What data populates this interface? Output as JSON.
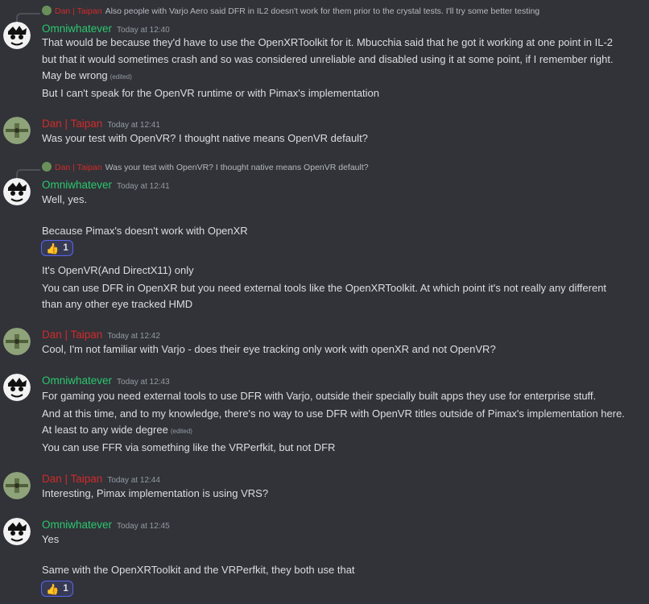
{
  "colors": {
    "background": "#313338",
    "omni_name": "#2dc770",
    "dan_name": "#d32a2a",
    "text": "#dbdee1",
    "muted": "#949ba4",
    "reaction_border": "#5865f2"
  },
  "top_reply": {
    "name": "Dan | Taipan",
    "text": "Also people with Varjo Aero said DFR in IL2 doesn't work for them prior to the crystal tests. I'll try some better testing"
  },
  "messages": [
    {
      "author": "Omniwhatever",
      "time": "Today at 12:40",
      "lines": [
        "That would be because they'd have to use the OpenXRToolkit for it. Mbucchia said that he got it working at one point in IL-2",
        "but that it would sometimes crash and so was considered unreliable and disabled using it at some point, if I remember right.",
        "May be wrong",
        "But I can't speak for the OpenVR runtime or with Pimax's implementation"
      ],
      "edited": "(edited)"
    },
    {
      "author": "Dan | Taipan",
      "time": "Today at 12:41",
      "lines": [
        "Was your test with OpenVR? I thought native means OpenVR default?"
      ]
    },
    {
      "reply": {
        "name": "Dan | Taipan",
        "text": "Was your test with OpenVR? I thought native means OpenVR default?"
      },
      "author": "Omniwhatever",
      "time": "Today at 12:41",
      "lines": [
        "Well, yes.",
        "Because Pimax's doesn't work with OpenXR",
        "It's OpenVR(And DirectX11) only",
        "You can use DFR in OpenXR but you need external tools like the OpenXRToolkit. At which point it's not really any different",
        "than any other eye tracked HMD"
      ],
      "reaction": {
        "emoji": "thumbs-up",
        "count": "1"
      }
    },
    {
      "author": "Dan | Taipan",
      "time": "Today at 12:42",
      "lines": [
        "Cool, I'm not familiar with Varjo - does their eye tracking only work with openXR and not OpenVR?"
      ]
    },
    {
      "author": "Omniwhatever",
      "time": "Today at 12:43",
      "lines": [
        "For gaming you need external tools to use DFR with Varjo, outside their specially built apps they use for enterprise stuff.",
        "And at this time, and to my knowledge, there's no way to use DFR with OpenVR titles outside of Pimax's implementation here.",
        "At least to any wide degree",
        "You can use FFR via something like the VRPerfkit, but not DFR"
      ],
      "edited": "(edited)"
    },
    {
      "author": "Dan | Taipan",
      "time": "Today at 12:44",
      "lines": [
        "Interesting, Pimax implementation is using VRS?"
      ]
    },
    {
      "author": "Omniwhatever",
      "time": "Today at 12:45",
      "lines": [
        "Yes",
        "Same with the OpenXRToolkit and the VRPerfkit, they both use that"
      ],
      "reaction": {
        "emoji": "thumbs-up",
        "count": "1"
      }
    }
  ]
}
